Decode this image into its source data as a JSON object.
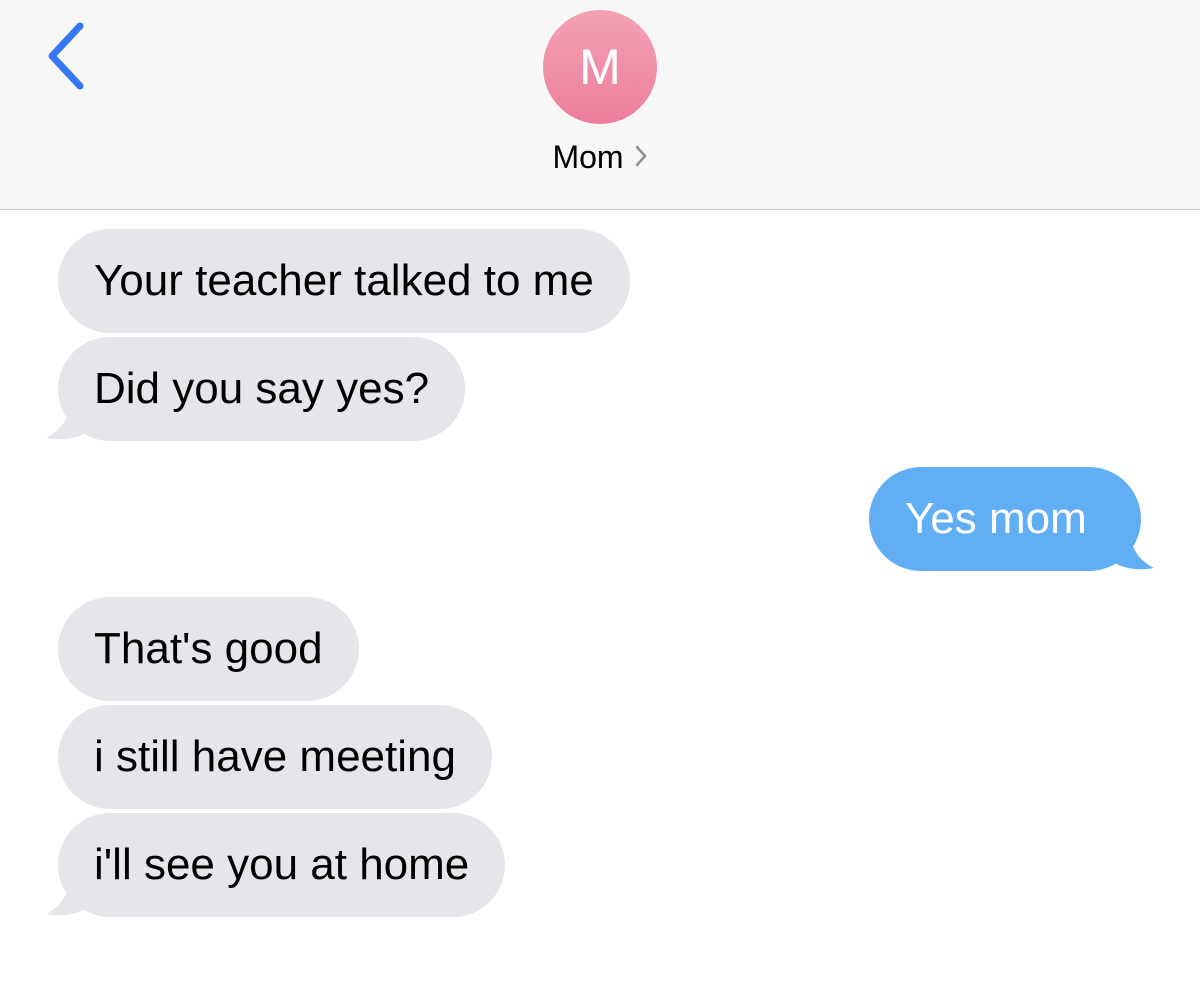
{
  "header": {
    "contact_initial": "M",
    "contact_name": "Mom",
    "back_icon": "chevron-left-icon",
    "name_chevron_icon": "chevron-right-icon"
  },
  "messages": [
    {
      "direction": "incoming",
      "text": "Your teacher talked to me"
    },
    {
      "direction": "incoming",
      "text": "Did you say yes?"
    },
    {
      "direction": "outgoing",
      "text": "Yes mom"
    },
    {
      "direction": "incoming",
      "text": "That's good"
    },
    {
      "direction": "incoming",
      "text": "i still have meeting"
    },
    {
      "direction": "incoming",
      "text": "i'll see you at home"
    }
  ],
  "colors": {
    "incoming_bubble": "#e5e5ea",
    "outgoing_bubble": "#62aef5",
    "accent": "#3478f6",
    "avatar": "#ef8ea8"
  }
}
